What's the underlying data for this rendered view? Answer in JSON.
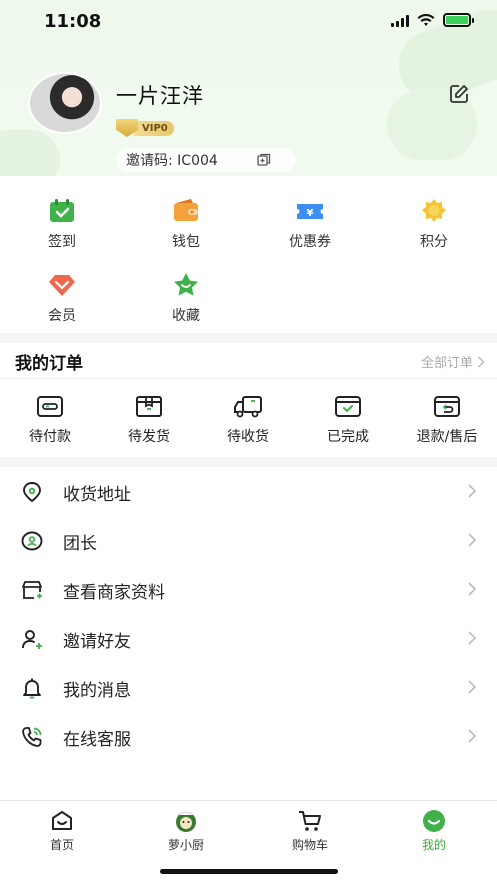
{
  "status_bar": {
    "time": "11:08"
  },
  "profile": {
    "username": "一片汪洋",
    "vip_label": "VIP0",
    "invite_code": "邀请码: IC004"
  },
  "quick_grid": [
    {
      "label": "签到",
      "icon": "calendar-check-icon"
    },
    {
      "label": "钱包",
      "icon": "wallet-icon"
    },
    {
      "label": "优惠券",
      "icon": "coupon-icon"
    },
    {
      "label": "积分",
      "icon": "points-badge-icon"
    },
    {
      "label": "会员",
      "icon": "member-diamond-icon"
    },
    {
      "label": "收藏",
      "icon": "favorite-star-icon"
    }
  ],
  "orders": {
    "title": "我的订单",
    "all_label": "全部订单",
    "items": [
      {
        "label": "待付款",
        "icon": "wallet-outline-icon"
      },
      {
        "label": "待发货",
        "icon": "box-icon"
      },
      {
        "label": "待收货",
        "icon": "truck-icon"
      },
      {
        "label": "已完成",
        "icon": "completed-box-icon"
      },
      {
        "label": "退款/售后",
        "icon": "refund-icon"
      }
    ]
  },
  "menu": [
    {
      "label": "收货地址",
      "icon": "location-icon"
    },
    {
      "label": "团长",
      "icon": "leader-icon"
    },
    {
      "label": "查看商家资料",
      "icon": "store-icon"
    },
    {
      "label": "邀请好友",
      "icon": "invite-user-icon"
    },
    {
      "label": "我的消息",
      "icon": "bell-icon"
    },
    {
      "label": "在线客服",
      "icon": "phone-icon"
    }
  ],
  "tabbar": [
    {
      "label": "首页",
      "icon": "home-icon",
      "active": false
    },
    {
      "label": "萝小厨",
      "icon": "chef-icon",
      "active": false
    },
    {
      "label": "购物车",
      "icon": "cart-icon",
      "active": false
    },
    {
      "label": "我的",
      "icon": "profile-smile-icon",
      "active": true
    }
  ],
  "colors": {
    "accent": "#3faa3f",
    "header_bg": "#eef9ec",
    "vip_gold": "#e8c66a"
  }
}
